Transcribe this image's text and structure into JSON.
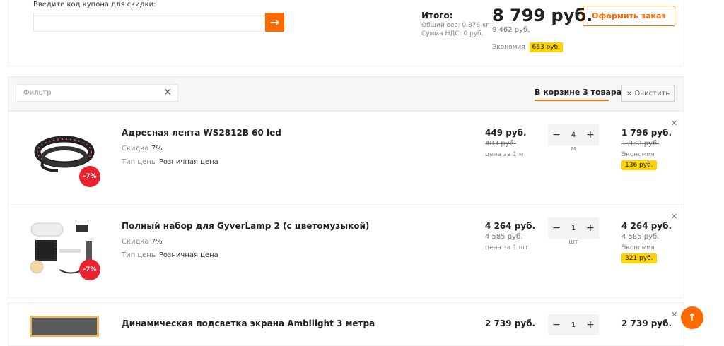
{
  "coupon": {
    "label": "Введите код купона для скидки:",
    "button_icon": "arrow-right-icon"
  },
  "summary": {
    "itogo": "Итого:",
    "weight": "Общий вес: 0.876 кг",
    "nds": "Сумма НДС: 0 руб.",
    "total": "8 799 руб.",
    "total_old": "9 462 руб.",
    "economy_label": "Экономия",
    "economy_value": "663 руб.",
    "order_button": "Оформить заказ"
  },
  "filter": {
    "placeholder": "Фильтр",
    "clear_icon": "close-icon"
  },
  "cart": {
    "tab": "В корзине 3 товара",
    "clear_button": "Очистить"
  },
  "items": [
    {
      "title": "Адресная лента WS2812B 60 led",
      "discount_label": "Скидка",
      "discount_value": "7%",
      "price_type_label": "Тип цены",
      "price_type_value": "Розничная цена",
      "badge": "-7%",
      "price": "449 руб.",
      "price_old": "483 руб.",
      "price_unit": "цена за 1 м",
      "qty": "4",
      "unit": "м",
      "sum": "1 796 руб.",
      "sum_old": "1 932 руб.",
      "economy_label": "Экономия",
      "economy": "136 руб."
    },
    {
      "title": "Полный набор для GyverLamp 2 (с цветомузыкой)",
      "discount_label": "Скидка",
      "discount_value": "7%",
      "price_type_label": "Тип цены",
      "price_type_value": "Розничная цена",
      "badge": "-7%",
      "price": "4 264 руб.",
      "price_old": "4 585 руб.",
      "price_unit": "цена за 1 шт",
      "qty": "1",
      "unit": "шт",
      "sum": "4 264 руб.",
      "sum_old": "4 585 руб.",
      "economy_label": "Экономия",
      "economy": "321 руб."
    },
    {
      "title": "Динамическая подсветка экрана Ambilight 3 метра",
      "price": "2 739 руб.",
      "qty": "1",
      "sum": "2 739 руб."
    }
  ],
  "colors": {
    "accent": "#ff6a00",
    "badge_red": "#e8232f",
    "economy_yellow": "#ffd400"
  }
}
